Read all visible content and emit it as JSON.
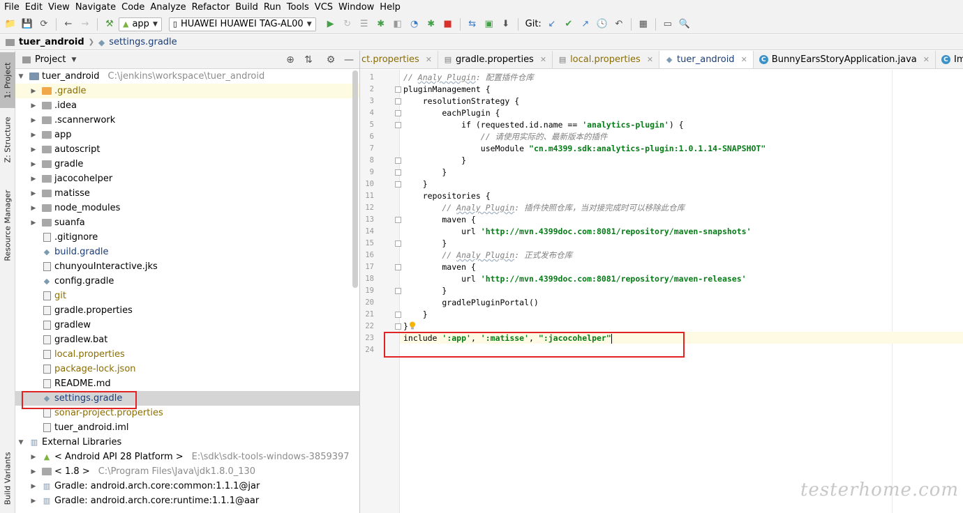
{
  "menu": [
    "File",
    "Edit",
    "View",
    "Navigate",
    "Code",
    "Analyze",
    "Refactor",
    "Build",
    "Run",
    "Tools",
    "VCS",
    "Window",
    "Help"
  ],
  "toolbar": {
    "run_config": "app",
    "device": "HUAWEI HUAWEI TAG-AL00",
    "git_label": "Git:"
  },
  "breadcrumb": {
    "project": "tuer_android",
    "file": "settings.gradle"
  },
  "side_tabs": {
    "project": "1: Project",
    "structure": "Z: Structure",
    "resource_manager": "Resource Manager",
    "build_variants": "Build Variants"
  },
  "project_panel": {
    "title": "Project",
    "root": {
      "name": "tuer_android",
      "path": "C:\\jenkins\\workspace\\tuer_android"
    },
    "items": [
      {
        "name": ".gradle",
        "kind": "folder-orange",
        "arrow": "▶"
      },
      {
        "name": ".idea",
        "kind": "folder",
        "arrow": "▶"
      },
      {
        "name": ".scannerwork",
        "kind": "folder",
        "arrow": "▶"
      },
      {
        "name": "app",
        "kind": "folder",
        "arrow": "▶"
      },
      {
        "name": "autoscript",
        "kind": "folder",
        "arrow": "▶"
      },
      {
        "name": "gradle",
        "kind": "folder",
        "arrow": "▶"
      },
      {
        "name": "jacocohelper",
        "kind": "folder",
        "arrow": "▶"
      },
      {
        "name": "matisse",
        "kind": "folder",
        "arrow": "▶"
      },
      {
        "name": "node_modules",
        "kind": "folder",
        "arrow": "▶"
      },
      {
        "name": "suanfa",
        "kind": "folder",
        "arrow": "▶"
      },
      {
        "name": ".gitignore",
        "kind": "file",
        "arrow": ""
      },
      {
        "name": "build.gradle",
        "kind": "gradle",
        "arrow": ""
      },
      {
        "name": "chunyouInteractive.jks",
        "kind": "file",
        "arrow": ""
      },
      {
        "name": "config.gradle",
        "kind": "gradle",
        "arrow": ""
      },
      {
        "name": "git",
        "kind": "file",
        "arrow": ""
      },
      {
        "name": "gradle.properties",
        "kind": "file",
        "arrow": ""
      },
      {
        "name": "gradlew",
        "kind": "file",
        "arrow": ""
      },
      {
        "name": "gradlew.bat",
        "kind": "file",
        "arrow": ""
      },
      {
        "name": "local.properties",
        "kind": "file",
        "arrow": ""
      },
      {
        "name": "package-lock.json",
        "kind": "file",
        "arrow": ""
      },
      {
        "name": "README.md",
        "kind": "file",
        "arrow": ""
      },
      {
        "name": "settings.gradle",
        "kind": "gradle",
        "arrow": ""
      },
      {
        "name": "sonar-project.properties",
        "kind": "file",
        "arrow": ""
      },
      {
        "name": "tuer_android.iml",
        "kind": "file",
        "arrow": ""
      }
    ],
    "external": {
      "name": "External Libraries",
      "items": [
        {
          "name": "< Android API 28 Platform >",
          "path": "E:\\sdk\\sdk-tools-windows-3859397"
        },
        {
          "name": "< 1.8 >",
          "path": "C:\\Program Files\\Java\\jdk1.8.0_130"
        },
        {
          "name": "Gradle: android.arch.core:common:1.1.1@jar",
          "path": ""
        },
        {
          "name": "Gradle: android.arch.core:runtime:1.1.1@aar",
          "path": ""
        }
      ]
    }
  },
  "editor": {
    "tabs": [
      {
        "label": "ct.properties",
        "icon": "file"
      },
      {
        "label": "gradle.properties",
        "icon": "file"
      },
      {
        "label": "local.properties",
        "icon": "file"
      },
      {
        "label": "tuer_android",
        "icon": "gradle"
      },
      {
        "label": "BunnyEarsStoryApplication.java",
        "icon": "class"
      },
      {
        "label": "ImageCompress",
        "icon": "class"
      }
    ],
    "line_numbers": [
      "1",
      "2",
      "3",
      "4",
      "5",
      "6",
      "7",
      "8",
      "9",
      "10",
      "11",
      "12",
      "13",
      "14",
      "15",
      "16",
      "17",
      "18",
      "19",
      "20",
      "21",
      "22",
      "23",
      "24"
    ],
    "lines": {
      "l1_slash": "// ",
      "l1_ul": "Analy Plugin",
      "l1_rest": ": 配置插件仓库",
      "l2": "pluginManagement {",
      "l3": "    resolutionStrategy {",
      "l4": "        eachPlugin {",
      "l5_a": "            if (requested.id.name == ",
      "l5_s": "'analytics-plugin'",
      "l5_b": ") {",
      "l6": "                // 请使用实际的、最新版本的插件",
      "l7_a": "                useModule ",
      "l7_s": "\"cn.m4399.sdk:analytics-plugin:1.0.1.14-SNAPSHOT\"",
      "l8": "            }",
      "l9": "        }",
      "l10": "    }",
      "l11": "    repositories {",
      "l12_slash": "        // ",
      "l12_ul": "Analy Plugin",
      "l12_rest": ": 插件快照仓库，当对接完成时可以移除此仓库",
      "l13": "        maven {",
      "l14_a": "            url ",
      "l14_s": "'http://mvn.4399doc.com:8081/repository/maven-snapshots'",
      "l15": "        }",
      "l16_slash": "        // ",
      "l16_ul": "Analy Plugin",
      "l16_rest": ": 正式发布仓库",
      "l17": "        maven {",
      "l18_a": "            url ",
      "l18_s": "'http://mvn.4399doc.com:8081/repository/maven-releases'",
      "l19": "        }",
      "l20": "        gradlePluginPortal()",
      "l21": "    }",
      "l22": "}",
      "l23_a": "include ",
      "l23_s1": "':app'",
      "l23_c1": ", ",
      "l23_s2": "':matisse'",
      "l23_c2": ", ",
      "l23_s3": "\":jacocohelper\""
    }
  },
  "watermark": "testerhome.com",
  "colors": {
    "highlight_box": "#e02424",
    "string": "#067d17",
    "comment": "#808080"
  }
}
